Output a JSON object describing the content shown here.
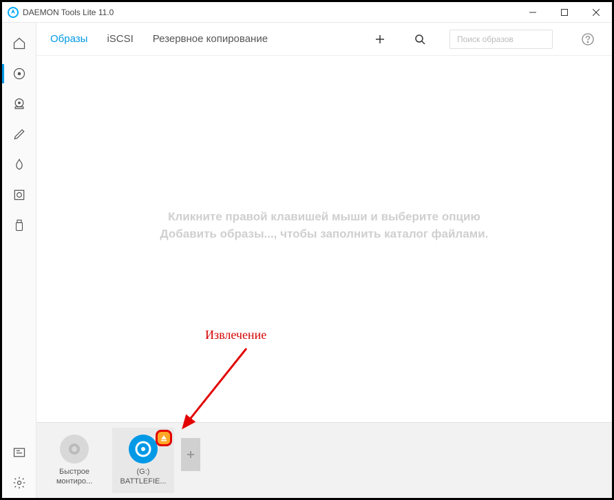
{
  "titlebar": {
    "title": "DAEMON Tools Lite 11.0"
  },
  "tabs": {
    "images": "Образы",
    "iscsi": "iSCSI",
    "backup": "Резервное копирование"
  },
  "search": {
    "placeholder": "Поиск образов"
  },
  "placeholder": {
    "text": "Кликните правой клавишей мыши и выберите опцию Добавить образы..., чтобы заполнить каталог файлами."
  },
  "drives": {
    "quick": {
      "line1": "Быстрое",
      "line2": "монтиро..."
    },
    "mounted": {
      "line1": "(G:)",
      "line2": "BATTLEFIE..."
    }
  },
  "annotation": {
    "label": "Извлечение"
  }
}
